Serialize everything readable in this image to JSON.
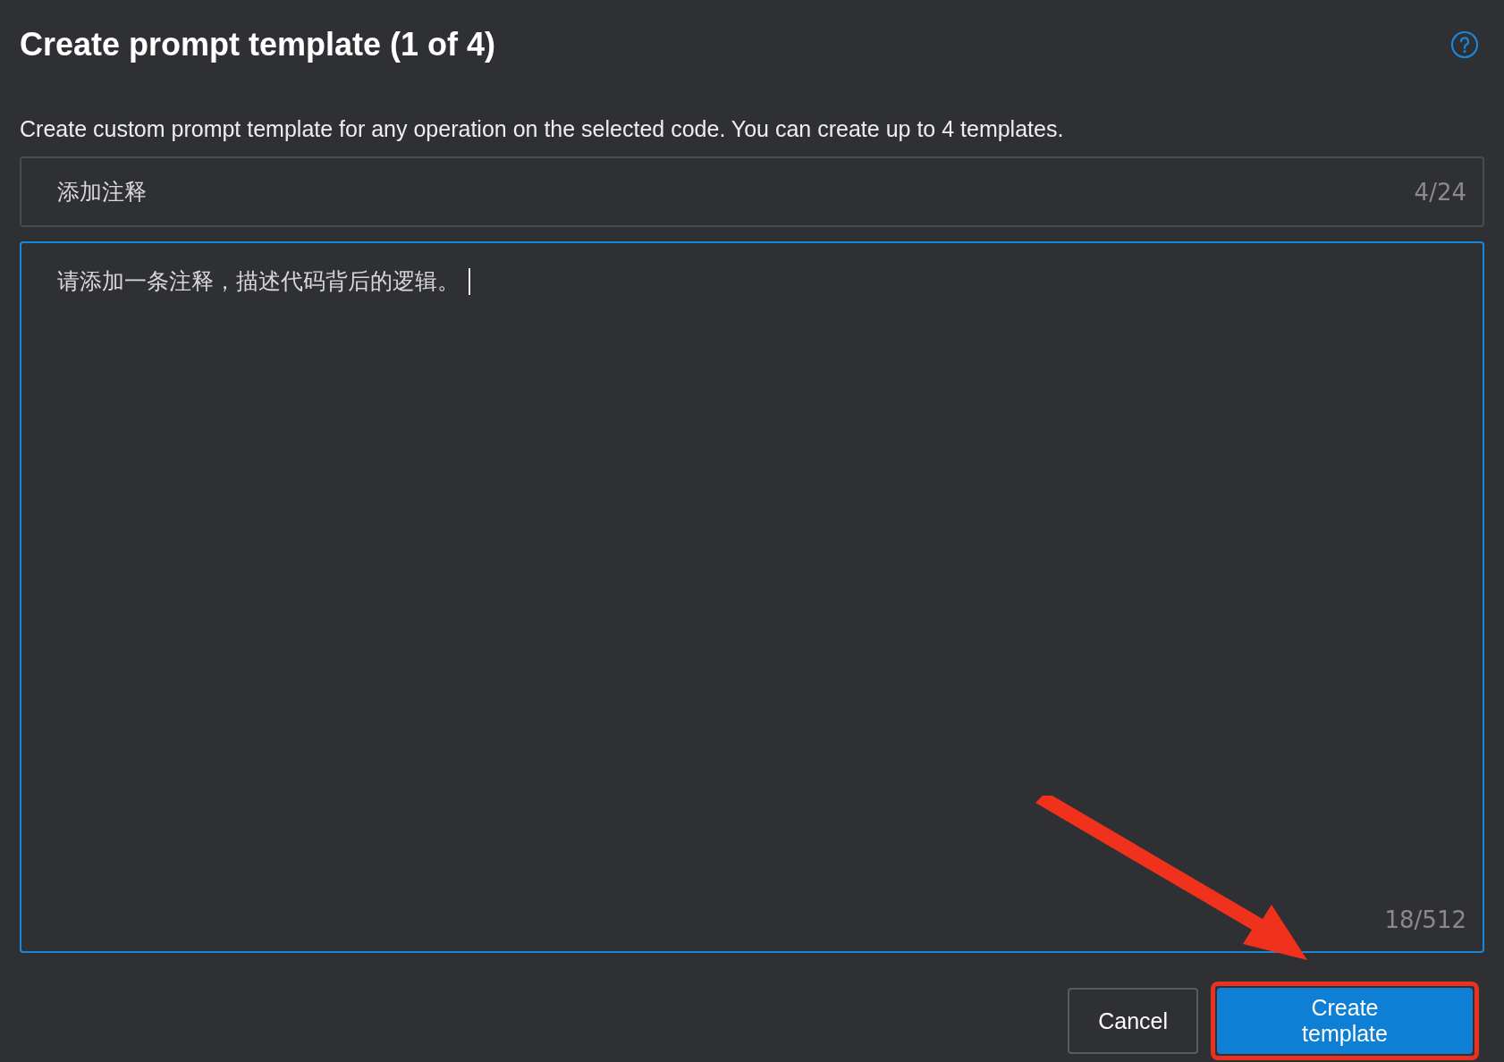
{
  "dialog": {
    "title": "Create prompt template (1 of 4)",
    "description": "Create custom prompt template for any operation on the selected code. You can create up to 4 templates."
  },
  "name_field": {
    "value": "添加注释",
    "counter": "4/24",
    "focused": false
  },
  "prompt_field": {
    "value": "请添加一条注释，描述代码背后的逻辑。",
    "counter": "18/512",
    "focused": true
  },
  "buttons": [
    {
      "label": "Cancel",
      "kind": "secondary"
    },
    {
      "label": "Create template",
      "kind": "primary"
    }
  ]
}
